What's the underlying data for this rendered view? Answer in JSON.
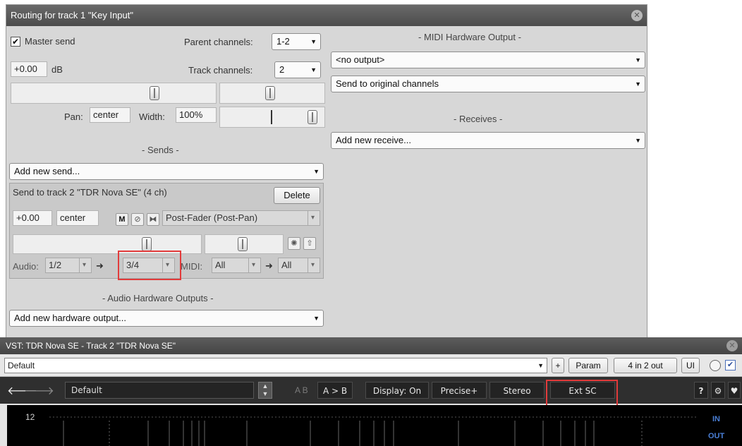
{
  "routing": {
    "title": "Routing for track 1 \"Key Input\"",
    "master_send_label": "Master send",
    "master_send_checked": true,
    "parent_channels_label": "Parent channels:",
    "parent_channels_value": "1-2",
    "volume_value": "+0.00",
    "volume_unit": "dB",
    "track_channels_label": "Track channels:",
    "track_channels_value": "2",
    "pan_label": "Pan:",
    "pan_value": "center",
    "width_label": "Width:",
    "width_value": "100%",
    "sends_header": "- Sends -",
    "add_send": "Add new send...",
    "send": {
      "title": "Send to track 2 \"TDR Nova SE\" (4 ch)",
      "delete_label": "Delete",
      "volume": "+0.00",
      "pan": "center",
      "mute_label": "M",
      "mode": "Post-Fader (Post-Pan)",
      "audio_label": "Audio:",
      "audio_src": "1/2",
      "audio_dst": "3/4",
      "midi_label": "MIDI:",
      "midi_src": "All",
      "midi_dst": "All"
    },
    "hw_outputs_header": "- Audio Hardware Outputs -",
    "add_hw_output": "Add new hardware output...",
    "midi_hw_header": "- MIDI Hardware Output -",
    "midi_output_value": "<no output>",
    "midi_channels_value": "Send to original channels",
    "receives_header": "- Receives -",
    "add_receive": "Add new receive..."
  },
  "vst": {
    "title": "VST: TDR Nova SE - Track 2 \"TDR Nova SE\"",
    "preset": "Default",
    "plus_label": "+",
    "param_label": "Param",
    "io_label": "4 in 2 out",
    "ui_label": "UI",
    "plugin_preset": "Default",
    "ab_label": "A B",
    "a_to_b_label": "A > B",
    "display_label": "Display: On",
    "precise_label": "Precise+",
    "stereo_label": "Stereo",
    "extsc_label": "Ext SC",
    "help_label": "?",
    "scale_12": "12",
    "in_label": "IN",
    "out_label": "OUT"
  }
}
